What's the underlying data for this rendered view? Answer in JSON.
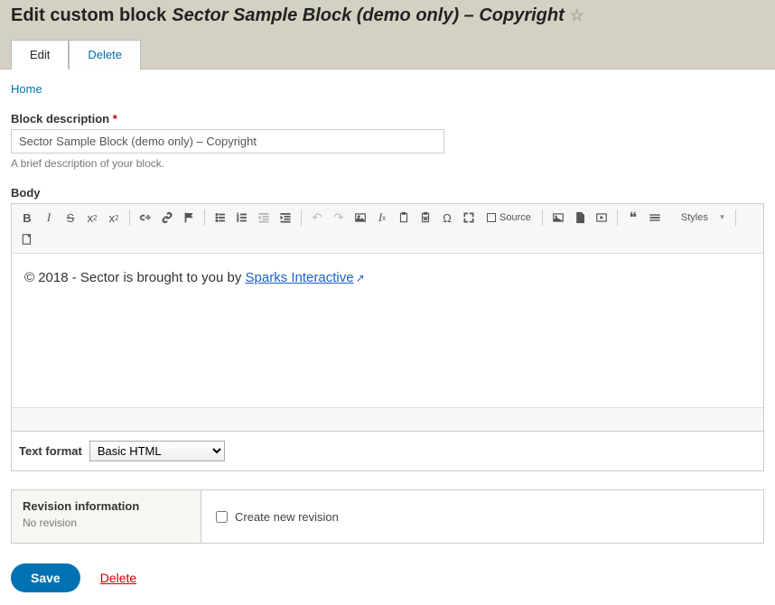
{
  "header": {
    "title_prefix": "Edit custom block",
    "title_italic": "Sector Sample Block (demo only) – Copyright"
  },
  "tabs": {
    "edit": "Edit",
    "delete": "Delete"
  },
  "breadcrumb": {
    "home": "Home"
  },
  "form": {
    "block_description_label": "Block description",
    "block_description_value": "Sector Sample Block (demo only) – Copyright",
    "block_description_help": "A brief description of your block.",
    "body_label": "Body"
  },
  "editor": {
    "source_label": "Source",
    "styles_label": "Styles",
    "content_prefix": "© 2018 - Sector is brought to you by ",
    "content_link": "Sparks Interactive"
  },
  "text_format": {
    "label": "Text format",
    "selected": "Basic HTML"
  },
  "revision": {
    "title": "Revision information",
    "summary": "No revision",
    "checkbox_label": "Create new revision"
  },
  "actions": {
    "save": "Save",
    "delete": "Delete"
  }
}
